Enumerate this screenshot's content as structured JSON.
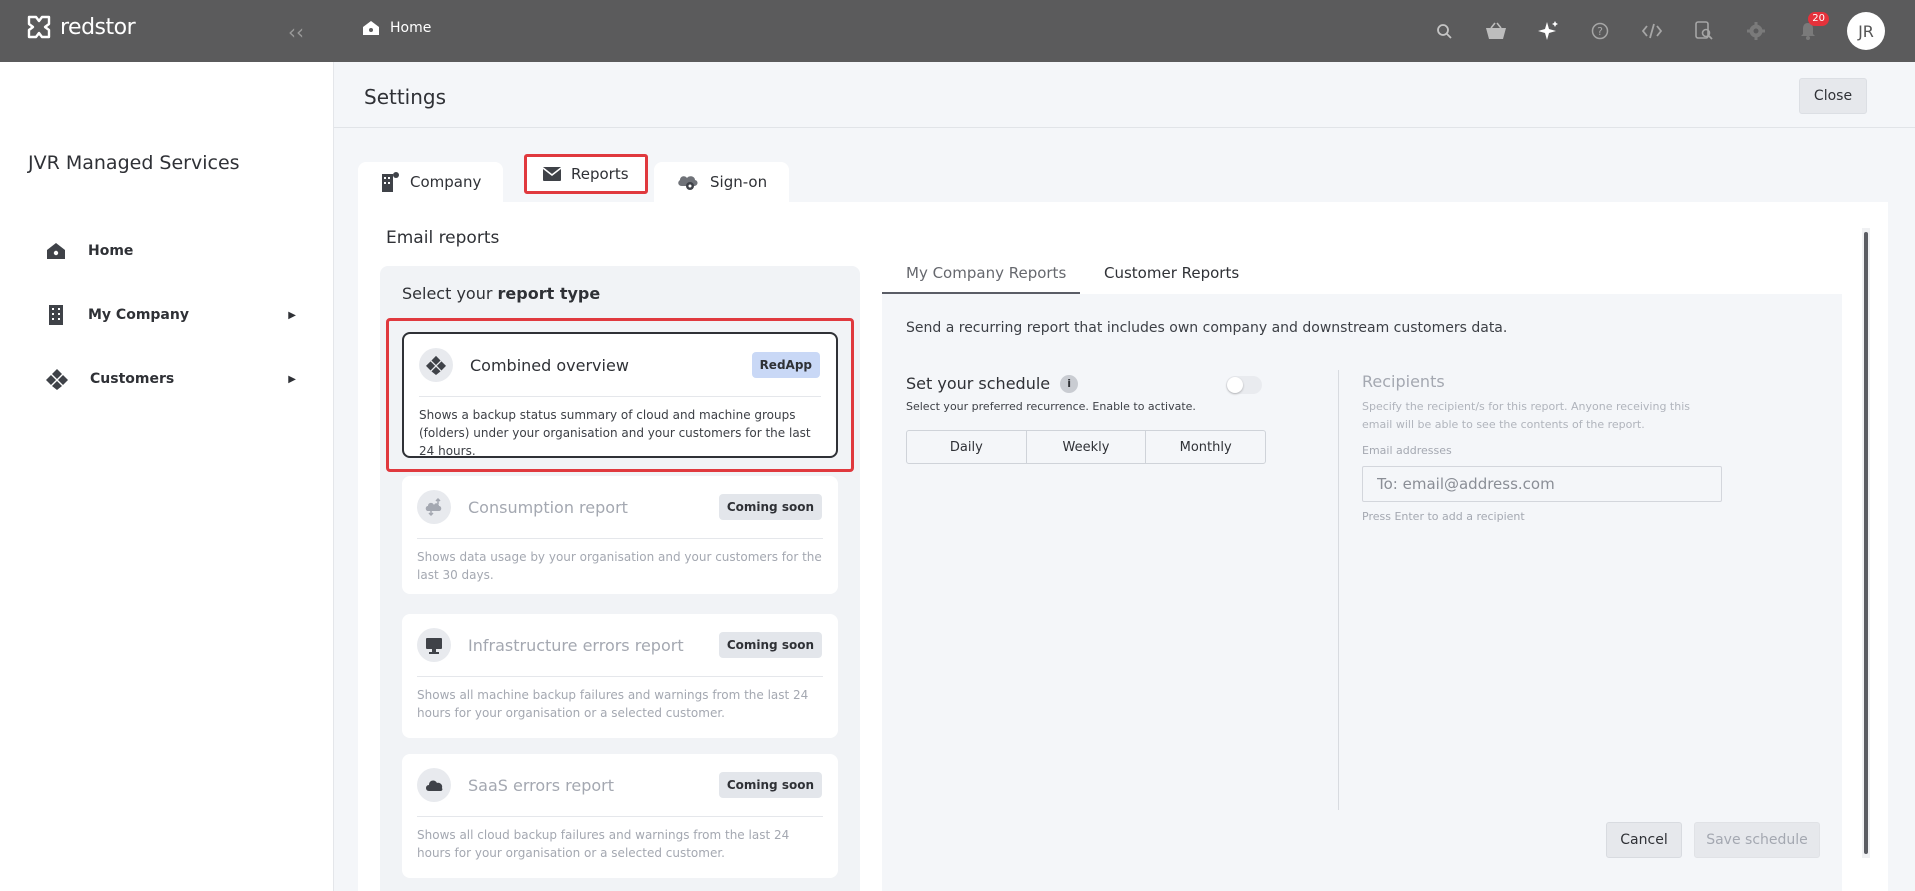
{
  "brand": {
    "name": "redstor"
  },
  "breadcrumb": {
    "label": "Home"
  },
  "topbar": {
    "notifications_count": "20",
    "user_initials": "JR"
  },
  "sidebar": {
    "org_name": "JVR Managed Services",
    "items": [
      {
        "label": "Home",
        "icon": "home-icon"
      },
      {
        "label": "My Company",
        "icon": "building-icon"
      },
      {
        "label": "Customers",
        "icon": "customers-icon"
      }
    ]
  },
  "settings": {
    "title": "Settings",
    "close_label": "Close",
    "tabs": [
      {
        "label": "Company"
      },
      {
        "label": "Reports"
      },
      {
        "label": "Sign-on"
      }
    ],
    "section_title": "Email reports",
    "report_type": {
      "prefix": "Select your ",
      "bold": "report type"
    },
    "reports": [
      {
        "title": "Combined overview",
        "tag": "RedApp",
        "desc": "Shows a backup status summary of cloud and machine groups (folders) under your organisation and your customers for the last 24 hours."
      },
      {
        "title": "Consumption report",
        "tag": "Coming soon",
        "desc": "Shows data usage by your organisation and your customers for the last 30 days."
      },
      {
        "title": "Infrastructure errors report",
        "tag": "Coming soon",
        "desc": "Shows all machine backup failures and warnings from the last 24 hours for your organisation or a selected customer."
      },
      {
        "title": "SaaS errors report",
        "tag": "Coming soon",
        "desc": "Shows all cloud backup failures and warnings from the last 24 hours for your organisation or a selected customer."
      }
    ],
    "subtabs": [
      {
        "label": "My Company Reports"
      },
      {
        "label": "Customer Reports"
      }
    ],
    "intro": "Send a recurring report that includes own company and downstream customers data.",
    "schedule": {
      "title": "Set your schedule",
      "info": "i",
      "subtitle": "Select your preferred recurrence. Enable to activate.",
      "options": [
        "Daily",
        "Weekly",
        "Monthly"
      ]
    },
    "recipients": {
      "title": "Recipients",
      "subtitle": "Specify the recipient/s for this report. Anyone receiving this email will be able to see the contents of the report.",
      "email_label": "Email addresses",
      "email_placeholder": "To: email@address.com",
      "hint": "Press Enter to add a recipient"
    },
    "cancel_label": "Cancel",
    "save_label": "Save schedule"
  }
}
